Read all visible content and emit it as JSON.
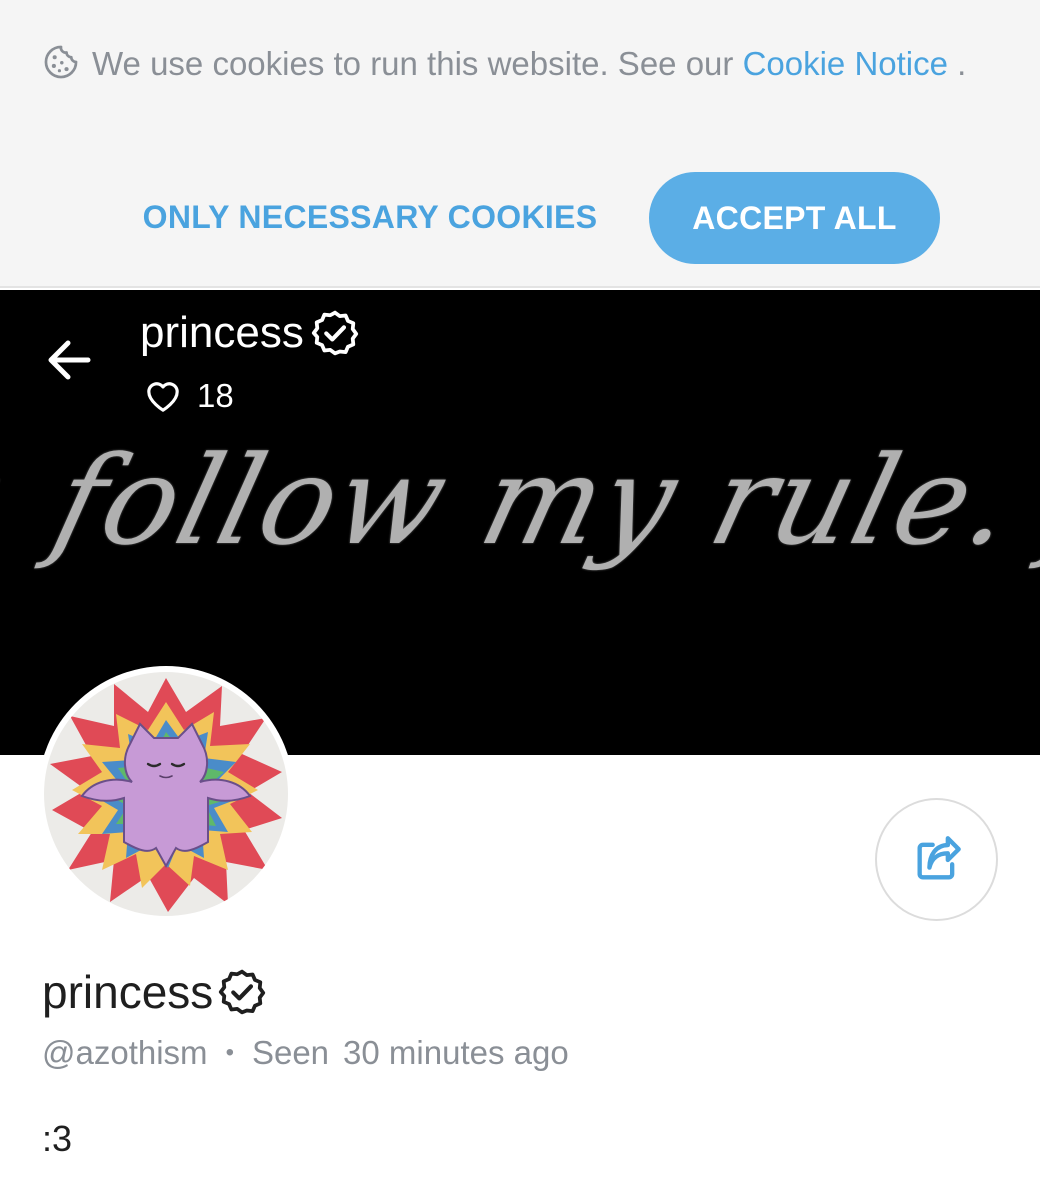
{
  "cookie_banner": {
    "message": "We use cookies to run this website. See our ",
    "link_text": "Cookie Notice",
    "link_suffix": " .",
    "necessary_label": "ONLY NECESSARY COOKIES",
    "accept_label": "ACCEPT ALL",
    "icon": "cookie-icon"
  },
  "header": {
    "title": "princess",
    "likes": "18",
    "back_icon": "arrow-left-icon",
    "like_icon": "heart-icon",
    "banner_text": "r. follow my rule. fina"
  },
  "profile": {
    "name": "princess",
    "handle": "@azothism",
    "separator": "•",
    "seen_label": "Seen",
    "seen_time": "30 minutes ago",
    "bio": ":3",
    "verified_icon": "verified-badge-icon",
    "share_icon": "share-icon"
  },
  "colors": {
    "accent": "#4aa3df",
    "accent_button": "#5baee6",
    "muted_text": "#8a8f96",
    "banner_bg": "#000000"
  }
}
